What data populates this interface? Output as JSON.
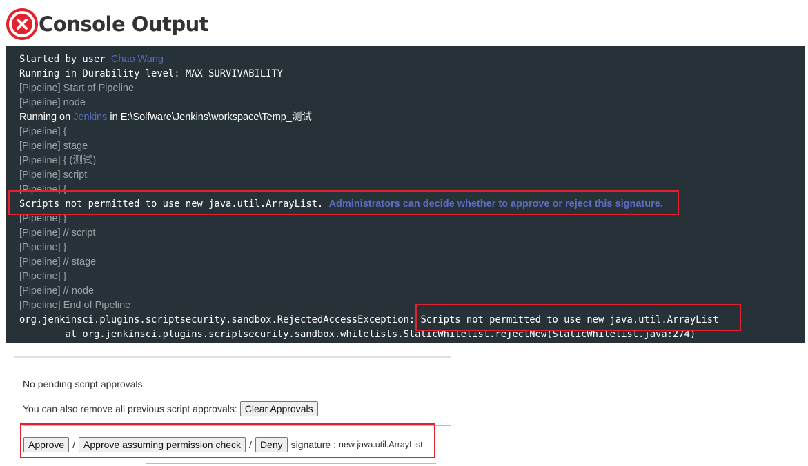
{
  "header": {
    "title": "Console Output",
    "status_icon": "failure-x-icon",
    "status_color": "#e3222d"
  },
  "console": {
    "bg_color": "#263238",
    "link_color": "#5c6bc0",
    "line1_prefix": "Started by user ",
    "line1_user": "Chao Wang",
    "line2": "Running in Durability level: MAX_SURVIVABILITY",
    "line3": "[Pipeline] Start of Pipeline",
    "line4": "[Pipeline] node",
    "line5_prefix": "Running on ",
    "line5_agent": "Jenkins",
    "line5_suffix": " in E:\\Solfware\\Jenkins\\workspace\\Temp_测试",
    "line6": "[Pipeline] {",
    "line7": "[Pipeline] stage",
    "line8": "[Pipeline] { (测试)",
    "line9": "[Pipeline] script",
    "line10": "[Pipeline] {",
    "line11_text": "Scripts not permitted to use new java.util.ArrayList. ",
    "line11_link": "Administrators can decide whether to approve or reject this signature.",
    "line12": "[Pipeline] }",
    "line13": "[Pipeline] // script",
    "line14": "[Pipeline] }",
    "line15": "[Pipeline] // stage",
    "line16": "[Pipeline] }",
    "line17": "[Pipeline] // node",
    "line18": "[Pipeline] End of Pipeline",
    "line19_exception": "org.jenkinsci.plugins.scriptsecurity.sandbox.RejectedAccessException",
    "line19_message": ": Scripts not permitted to use new java.util.ArrayList",
    "line20": "\tat org.jenkinsci.plugins.scriptsecurity.sandbox.whitelists.StaticWhitelist.rejectNew(StaticWhitelist.java:274)"
  },
  "approvals": {
    "no_pending": "No pending script approvals.",
    "remove_prefix": "You can also remove all previous script approvals:",
    "clear_button": "Clear Approvals",
    "approve_button": "Approve",
    "separator": "/",
    "approve_assuming_button": "Approve assuming permission check",
    "deny_button": "Deny",
    "signature_label": "signature :",
    "signature_value": "new java.util.ArrayList"
  },
  "highlight_color": "#e3222d"
}
